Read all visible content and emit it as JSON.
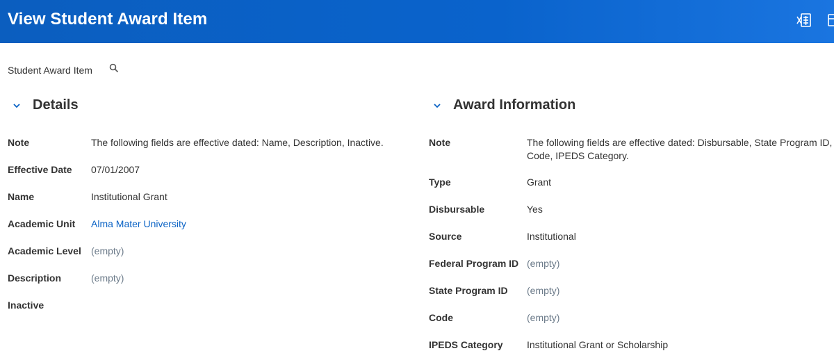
{
  "header": {
    "title": "View Student Award Item",
    "icons": [
      "export-to-excel-icon",
      "print-icon"
    ],
    "background": "#0b5ebf"
  },
  "subject": {
    "label": "Student Award Item",
    "icon": "search-icon"
  },
  "details": {
    "title": "Details",
    "fields": [
      {
        "label": "Note",
        "value": "The following fields are effective dated: Name, Description, Inactive."
      },
      {
        "label": "Effective Date",
        "value": "07/01/2007"
      },
      {
        "label": "Name",
        "value": "Institutional Grant"
      },
      {
        "label": "Academic Unit",
        "value": "Alma Mater University"
      },
      {
        "label": "Academic Level",
        "value": "(empty)"
      },
      {
        "label": "Description",
        "value": "(empty)"
      },
      {
        "label": "Inactive",
        "value": ""
      }
    ]
  },
  "award_information": {
    "title": "Award Information",
    "fields": [
      {
        "label": "Note",
        "value_line1": "The following fields are effective dated: Disbursable, State Program ID,",
        "value_line2": "Code, IPEDS Category."
      },
      {
        "label": "Type",
        "value": "Grant"
      },
      {
        "label": "Disbursable",
        "value": "Yes"
      },
      {
        "label": "Source",
        "value": "Institutional"
      },
      {
        "label": "Federal Program ID",
        "value": "(empty)"
      },
      {
        "label": "State Program ID",
        "value": "(empty)"
      },
      {
        "label": "Code",
        "value": "(empty)"
      },
      {
        "label": "IPEDS Category",
        "value": "Institutional Grant or Scholarship"
      }
    ]
  },
  "colors": {
    "link": "#0b63c5",
    "empty_text": "#6b7a89",
    "chevron": "#0b63c5"
  }
}
